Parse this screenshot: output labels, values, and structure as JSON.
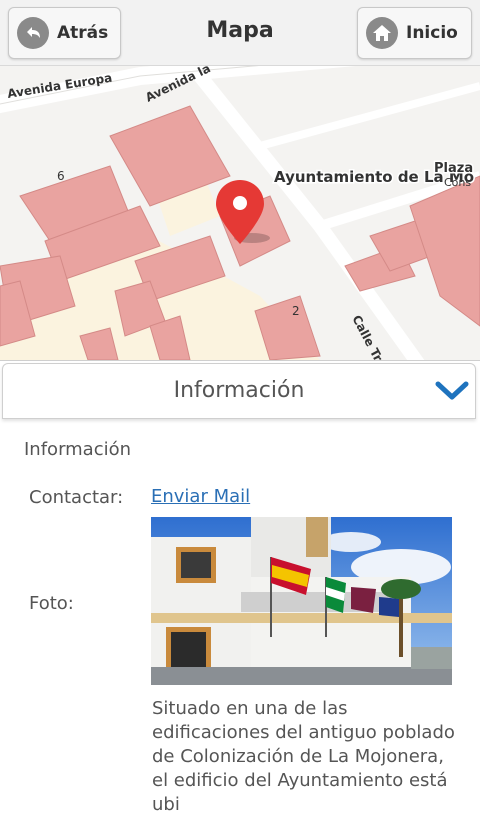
{
  "header": {
    "back_label": "Atrás",
    "title": "Mapa",
    "home_label": "Inicio"
  },
  "map": {
    "streets": [
      "Avenida Europa",
      "Avenida la",
      "Calle Tr"
    ],
    "places": [
      "Ayuntamiento de La Mo",
      "Plaza",
      "Cons"
    ],
    "house_numbers": [
      "6",
      "2"
    ],
    "colors": {
      "building": "#e9a3a0",
      "road": "#ffffff",
      "block": "#fbf3df",
      "marker": "#e53935"
    }
  },
  "panel": {
    "title": "Información",
    "section_title": "Información",
    "contact_label": "Contactar:",
    "contact_link": "Enviar Mail",
    "photo_label": "Foto:",
    "description": "Situado en una de las edificaciones del antiguo poblado de Colonización de La Mojonera, el edificio del Ayuntamiento está ubi"
  }
}
